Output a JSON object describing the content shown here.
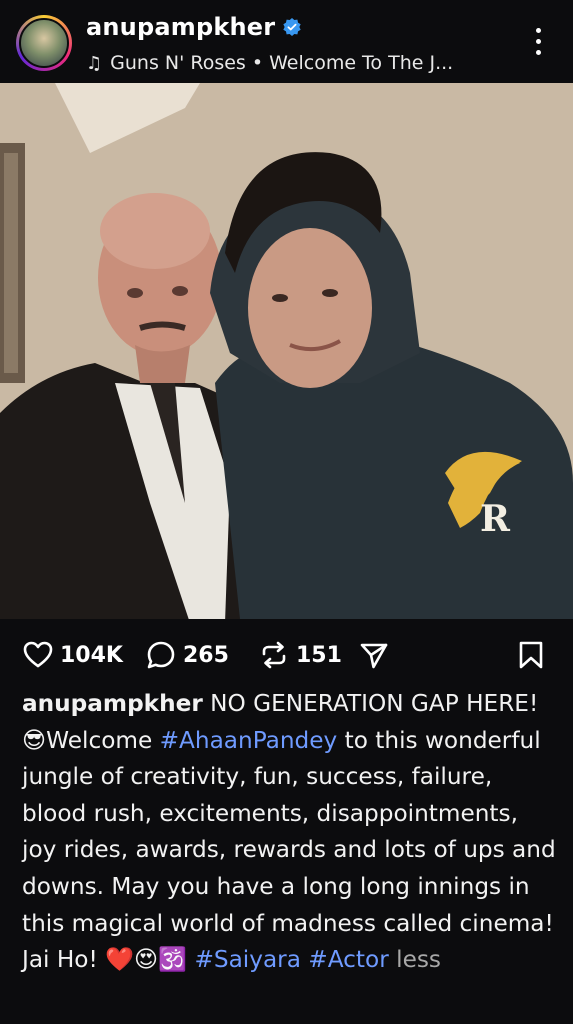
{
  "header": {
    "username": "anupampkher",
    "verified": true,
    "music_icon": "music-note-icon",
    "music_text": "Guns N' Roses • Welcome To The J..."
  },
  "post": {
    "likes": "104K",
    "comments": "265",
    "reposts": "151"
  },
  "caption": {
    "username": "anupampkher",
    "segments": [
      {
        "type": "text",
        "value": " NO GENERATION GAP HERE! 😎Welcome "
      },
      {
        "type": "tag",
        "value": "#AhaanPandey"
      },
      {
        "type": "text",
        "value": " to this wonderful jungle of creativity, fun, success, failure, blood rush, excitements, disappointments, joy rides, awards, rewards and lots of ups and downs. May you have a long long innings in this magical world of madness called cinema! Jai Ho! ❤️😍🕉️ "
      },
      {
        "type": "tag",
        "value": "#Saiyara"
      },
      {
        "type": "text",
        "value": " "
      },
      {
        "type": "tag",
        "value": "#Actor"
      },
      {
        "type": "text",
        "value": " "
      }
    ],
    "more_label": "less"
  },
  "colors": {
    "background": "#0c0c0e",
    "hashtag": "#6f9bff",
    "verified_badge": "#3897f0"
  }
}
